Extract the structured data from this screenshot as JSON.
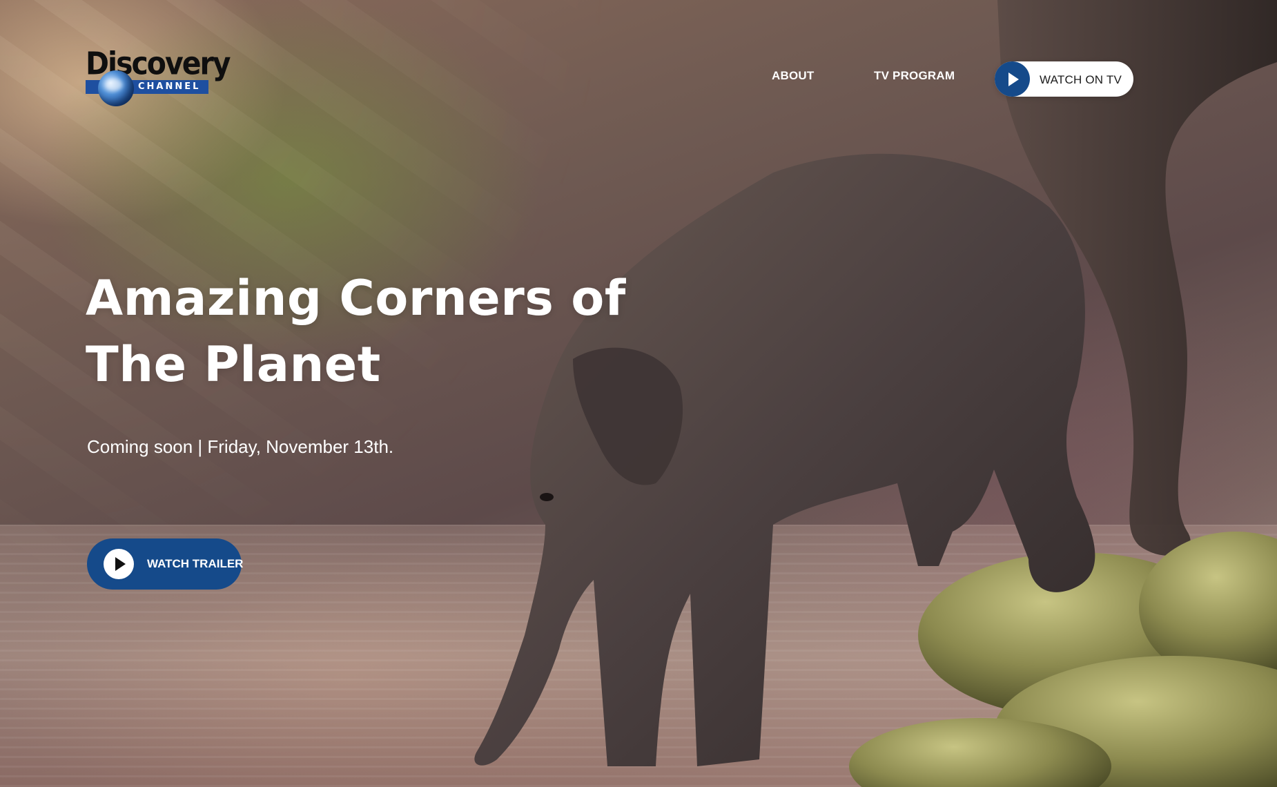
{
  "brand": {
    "logo_word": "Discovery",
    "logo_channel": "CHANNEL"
  },
  "nav": {
    "about": "ABOUT",
    "tv_program": "TV PROGRAM",
    "watch_on_tv": "WATCH ON TV"
  },
  "hero": {
    "title_line1": "Amazing Corners of",
    "title_line2": "The Planet",
    "subtitle": "Coming soon | Friday, November 13th.",
    "cta_label": "WATCH TRAILER",
    "background_image": "baby elephant drinking from a river, adult elephant and mossy rocks, sunlit forest"
  },
  "colors": {
    "accent_blue": "#154a8a",
    "text_white": "#ffffff"
  },
  "icons": {
    "watch_on_tv": "play-icon",
    "watch_trailer": "play-icon"
  }
}
